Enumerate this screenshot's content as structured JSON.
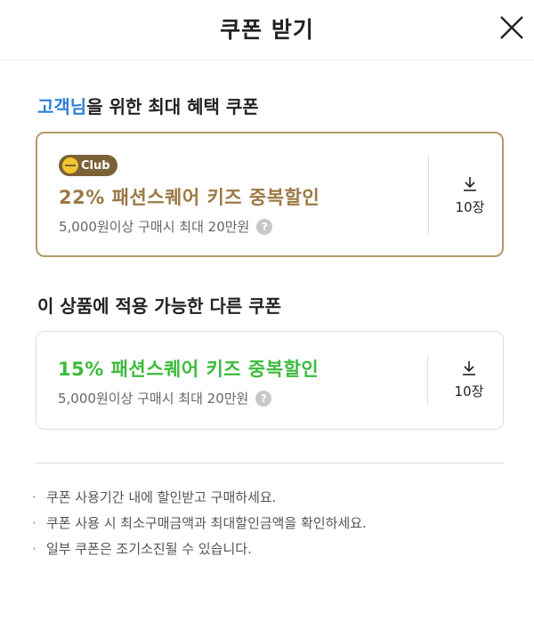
{
  "header": {
    "title": "쿠폰 받기",
    "close_icon": "close-icon"
  },
  "section1": {
    "title_highlight": "고객님",
    "title_rest": "을 위한 최대 혜택 쿠폰"
  },
  "coupons_best": [
    {
      "badge": "Club",
      "name": "22% 패션스퀘어 키즈 중복할인",
      "condition": "5,000원이상 구매시 최대 20만원",
      "help": "?",
      "download_count": "10장",
      "accent": "#9a7a44",
      "border": "#b39a6a"
    }
  ],
  "section2": {
    "title": "이 상품에 적용 가능한 다른 쿠폰"
  },
  "coupons_other": [
    {
      "name": "15% 패션스퀘어 키즈 중복할인",
      "condition": "5,000원이상 구매시 최대 20만원",
      "help": "?",
      "download_count": "10장",
      "accent": "#3dbb3d"
    }
  ],
  "notes": [
    "쿠폰 사용기간 내에 할인받고 구매하세요.",
    "쿠폰 사용 시 최소구매금액과 최대할인금액을 확인하세요.",
    "일부 쿠폰은 조기소진될 수 있습니다."
  ]
}
